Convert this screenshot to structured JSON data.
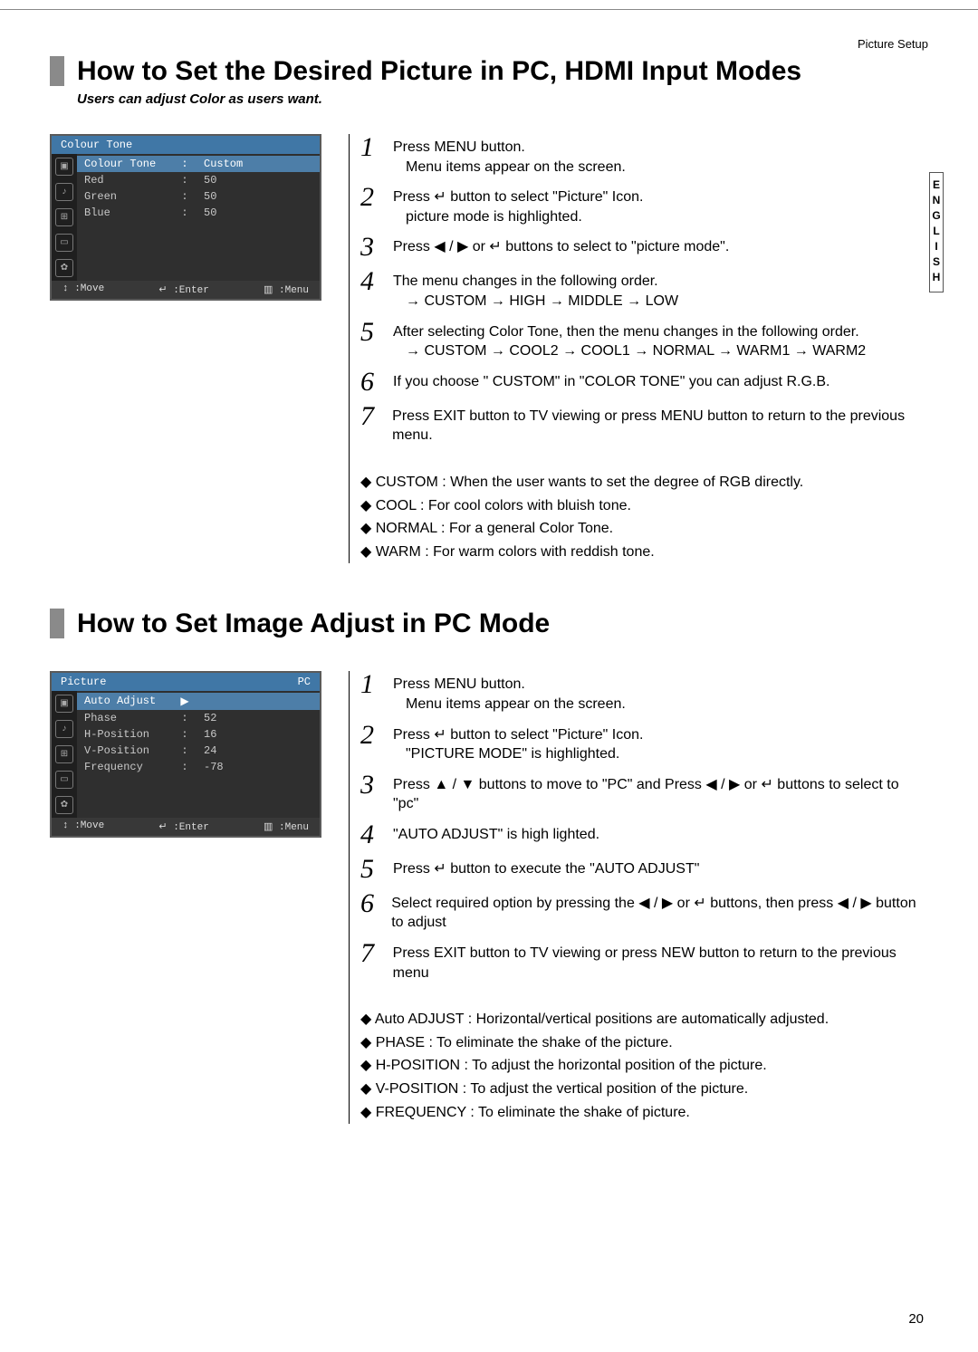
{
  "header": "Picture Setup",
  "language_tab": "ENGLISH",
  "page_number": "20",
  "section1": {
    "title": "How to Set the Desired Picture in PC, HDMI Input Modes",
    "subtitle": "Users can adjust Color as users want.",
    "osd": {
      "title_left": "Colour Tone",
      "title_right": "",
      "rows": [
        {
          "label": "Colour Tone",
          "sel": ":",
          "value": "Custom",
          "hl": true
        },
        {
          "label": "Red",
          "sel": ":",
          "value": "50"
        },
        {
          "label": "Green",
          "sel": ":",
          "value": "50"
        },
        {
          "label": "Blue",
          "sel": ":",
          "value": "50"
        }
      ],
      "footer": {
        "move": "↕ :Move",
        "enter": "↵ :Enter",
        "menu": "▥ :Menu"
      }
    },
    "steps": [
      {
        "n": "1",
        "lines": [
          "Press MENU button.",
          "Menu items appear on the screen."
        ]
      },
      {
        "n": "2",
        "lines": [
          "Press ↵ button to select \"Picture\" Icon.",
          "picture mode is highlighted."
        ]
      },
      {
        "n": "3",
        "lines": [
          "Press ◀ / ▶ or ↵ buttons to select to \"picture mode\"."
        ]
      },
      {
        "n": "4",
        "lines": [
          "The menu changes in the following order.",
          "→ CUSTOM → HIGH → MIDDLE → LOW"
        ]
      },
      {
        "n": "5",
        "lines": [
          "After selecting Color Tone, then the menu changes in the following order.",
          "→ CUSTOM → COOL2 → COOL1 → NORMAL → WARM1 → WARM2"
        ]
      },
      {
        "n": "6",
        "lines": [
          "If you choose \" CUSTOM\" in \"COLOR TONE\" you can adjust R.G.B."
        ]
      },
      {
        "n": "7",
        "lines": [
          "Press EXIT button to TV viewing or press MENU button to return to the previous menu."
        ]
      }
    ],
    "notes": [
      "CUSTOM : When the user wants to set the degree of RGB directly.",
      "COOL : For cool colors with bluish tone.",
      "NORMAL : For a general Color Tone.",
      "WARM : For warm colors with reddish tone."
    ]
  },
  "section2": {
    "title": "How to Set Image Adjust in PC Mode",
    "osd": {
      "title_left": "Picture",
      "title_right": "PC",
      "rows": [
        {
          "label": "Auto Adjust",
          "sel": "▶",
          "value": "",
          "hl": true
        },
        {
          "label": "Phase",
          "sel": ":",
          "value": "52"
        },
        {
          "label": "H-Position",
          "sel": ":",
          "value": "16"
        },
        {
          "label": "V-Position",
          "sel": ":",
          "value": "24"
        },
        {
          "label": "Frequency",
          "sel": ":",
          "value": "-78"
        }
      ],
      "footer": {
        "move": "↕ :Move",
        "enter": "↵ :Enter",
        "menu": "▥ :Menu"
      }
    },
    "steps": [
      {
        "n": "1",
        "lines": [
          "Press MENU button.",
          "Menu items appear on the screen."
        ]
      },
      {
        "n": "2",
        "lines": [
          "Press ↵ button to select \"Picture\" Icon.",
          "\"PICTURE MODE\" is highlighted."
        ]
      },
      {
        "n": "3",
        "lines": [
          "Press ▲ / ▼ buttons to move to \"PC\" and Press ◀ / ▶ or ↵ buttons to select to \"pc\""
        ]
      },
      {
        "n": "4",
        "lines": [
          "\"AUTO ADJUST\" is high lighted."
        ]
      },
      {
        "n": "5",
        "lines": [
          "Press ↵ button to execute the \"AUTO ADJUST\""
        ]
      },
      {
        "n": "6",
        "lines": [
          "Select required option by pressing the ◀ / ▶ or ↵ buttons, then  press ◀ / ▶ button to adjust"
        ]
      },
      {
        "n": "7",
        "lines": [
          "Press EXIT button to TV viewing or press NEW button to return to the previous menu"
        ]
      }
    ],
    "notes": [
      "Auto ADJUST : Horizontal/vertical positions are automatically adjusted.",
      "PHASE : To eliminate the shake of the picture.",
      "H-POSITION : To adjust the horizontal position of the picture.",
      "V-POSITION : To adjust the vertical position of the picture.",
      "FREQUENCY : To eliminate the shake of picture."
    ]
  }
}
